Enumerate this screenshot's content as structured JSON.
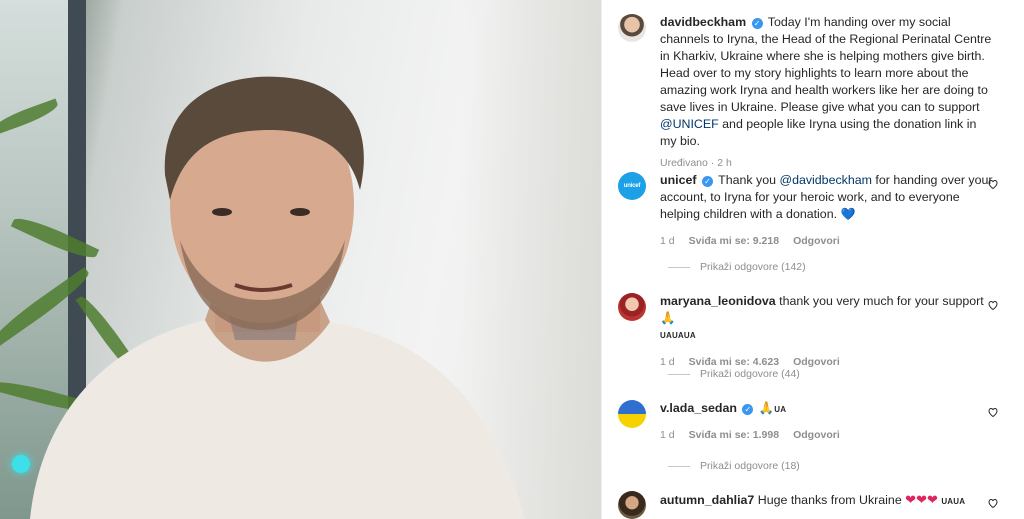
{
  "post": {
    "author": "davidbeckham",
    "caption": "Today I'm handing over my social channels to Iryna, the Head of the Regional Perinatal Centre in Kharkiv, Ukraine where she is helping mothers give birth. Head over to my story highlights to learn more about the amazing work Iryna and health workers like her are doing to save lives in Ukraine. Please give what you can to support",
    "caption_mention": "@UNICEF",
    "caption_end": "and people like Iryna using the donation link in my bio.",
    "meta": "Uređivano · 2 h"
  },
  "comments": [
    {
      "username": "unicef",
      "text_before": "Thank you",
      "mention": "@davidbeckham",
      "text_after": "for handing over your account, to Iryna for your heroic work, and to everyone helping children with a donation.",
      "emoji": "💙",
      "age": "1 d",
      "likes": "Sviđa mi se: 9.218",
      "reply_label": "Odgovori",
      "replies_label": "Prikaži odgovore (142)",
      "avatar_text": "unicef"
    },
    {
      "username": "maryana_leonidova",
      "text": "thank you very much for your support",
      "emoji": "🙏",
      "tag": "UAUAUA",
      "age": "1 d",
      "likes": "Sviđa mi se: 4.623",
      "reply_label": "Odgovori",
      "replies_label": "Prikaži odgovore (44)"
    },
    {
      "username": "v.lada_sedan",
      "emoji": "🙏",
      "tag": "UA",
      "age": "1 d",
      "likes": "Sviđa mi se: 1.998",
      "reply_label": "Odgovori",
      "replies_label": "Prikaži odgovore (18)"
    },
    {
      "username": "autumn_dahlia7",
      "text": "Huge thanks from Ukraine",
      "emoji": "❤❤❤",
      "tag": "UAUA"
    }
  ],
  "icons": {
    "verified": "✓",
    "like": "heart-outline-icon"
  },
  "colors": {
    "verified_blue": "#3897f0",
    "mention_blue": "#00376b",
    "unicef_blue": "#1ca1e6"
  }
}
